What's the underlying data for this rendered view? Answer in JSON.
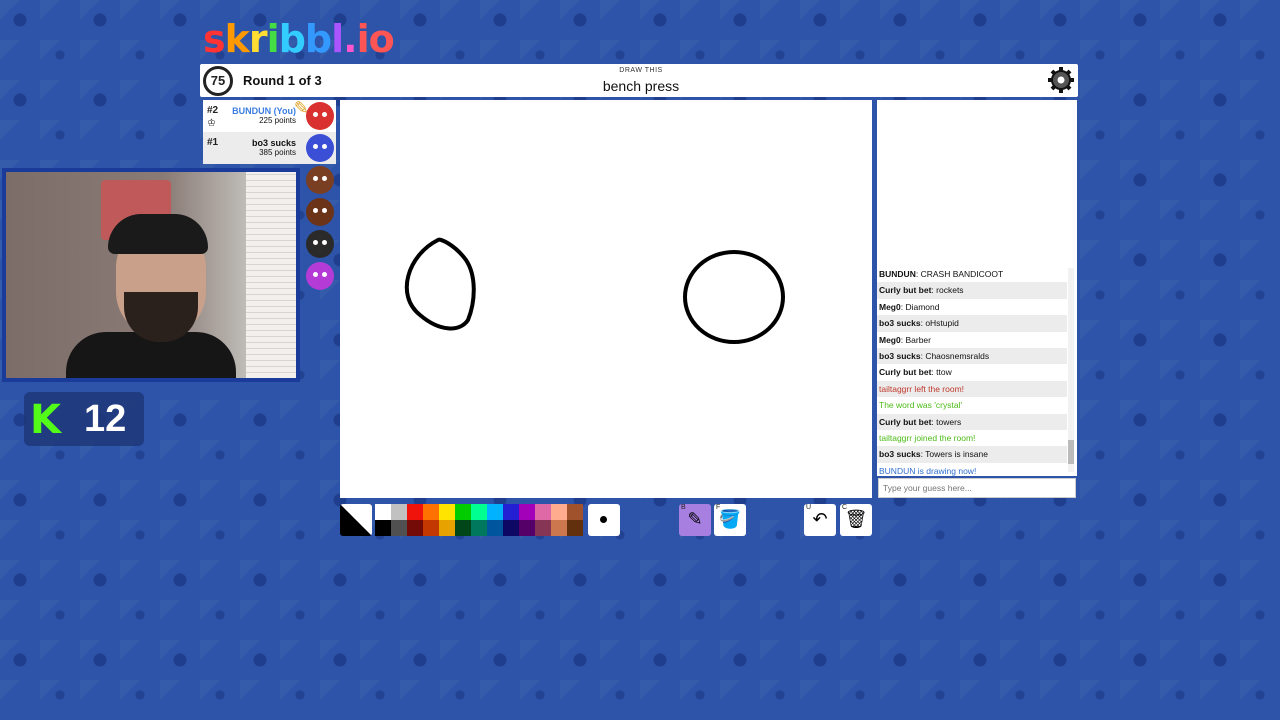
{
  "logo": [
    "s",
    "k",
    "r",
    "i",
    "b",
    "b",
    "l",
    ".io"
  ],
  "timer": "75",
  "round": "Round 1 of 3",
  "prompt": {
    "label": "DRAW THIS",
    "word": "bench press"
  },
  "players": [
    {
      "rank": "#2",
      "name": "BUNDUN (You)",
      "points": "225 points",
      "you": true,
      "avatar_color": "#d93030"
    },
    {
      "rank": "#1",
      "name": "bo3 sucks",
      "points": "385 points",
      "you": false,
      "avatar_color": "#3a4fd6"
    }
  ],
  "extra_avatars": [
    "#7a3f22",
    "#6b3418",
    "#2a2a2a",
    "#b53bd6"
  ],
  "chat": [
    {
      "who": "BUNDUN",
      "text": "CRASH BANDICOOT",
      "kind": "msg"
    },
    {
      "who": "Curly but bet",
      "text": "rockets",
      "kind": "msg"
    },
    {
      "who": "Meg0",
      "text": "Diamond",
      "kind": "msg"
    },
    {
      "who": "bo3 sucks",
      "text": "oHstupid",
      "kind": "msg"
    },
    {
      "who": "Meg0",
      "text": "Barber",
      "kind": "msg"
    },
    {
      "who": "bo3 sucks",
      "text": "Chaosnemsralds",
      "kind": "msg"
    },
    {
      "who": "Curly but bet",
      "text": "ttow",
      "kind": "msg"
    },
    {
      "who": "",
      "text": "tailtaggrr left the room!",
      "kind": "red"
    },
    {
      "who": "",
      "text": "The word was 'crystal'",
      "kind": "green"
    },
    {
      "who": "Curly but bet",
      "text": "towers",
      "kind": "msg"
    },
    {
      "who": "",
      "text": "tailtaggrr joined the room!",
      "kind": "green"
    },
    {
      "who": "bo3 sucks",
      "text": "Towers is insane",
      "kind": "msg"
    },
    {
      "who": "",
      "text": "BUNDUN is drawing now!",
      "kind": "blue"
    }
  ],
  "guess_placeholder": "Type your guess here...",
  "palette": [
    "#ffffff",
    "#c1c1c1",
    "#ef130b",
    "#ff7100",
    "#ffe400",
    "#00cc00",
    "#00ff91",
    "#00b2ff",
    "#231fd3",
    "#a300ba",
    "#df69a7",
    "#ffac8e",
    "#a0522d",
    "#000000",
    "#505050",
    "#740b07",
    "#c23800",
    "#e8a200",
    "#004619",
    "#00785d",
    "#00569e",
    "#0e0865",
    "#550069",
    "#873554",
    "#cc774d",
    "#63300d"
  ],
  "tools": [
    {
      "key": "B",
      "icon": "pencil-icon",
      "glyph": "✎"
    },
    {
      "key": "F",
      "icon": "fill-icon",
      "glyph": "🪣"
    },
    {
      "key": "U",
      "icon": "undo-icon",
      "glyph": "↶"
    },
    {
      "key": "C",
      "icon": "trash-icon",
      "glyph": "🗑"
    }
  ],
  "kick": {
    "count": "12",
    "logo": "K"
  }
}
